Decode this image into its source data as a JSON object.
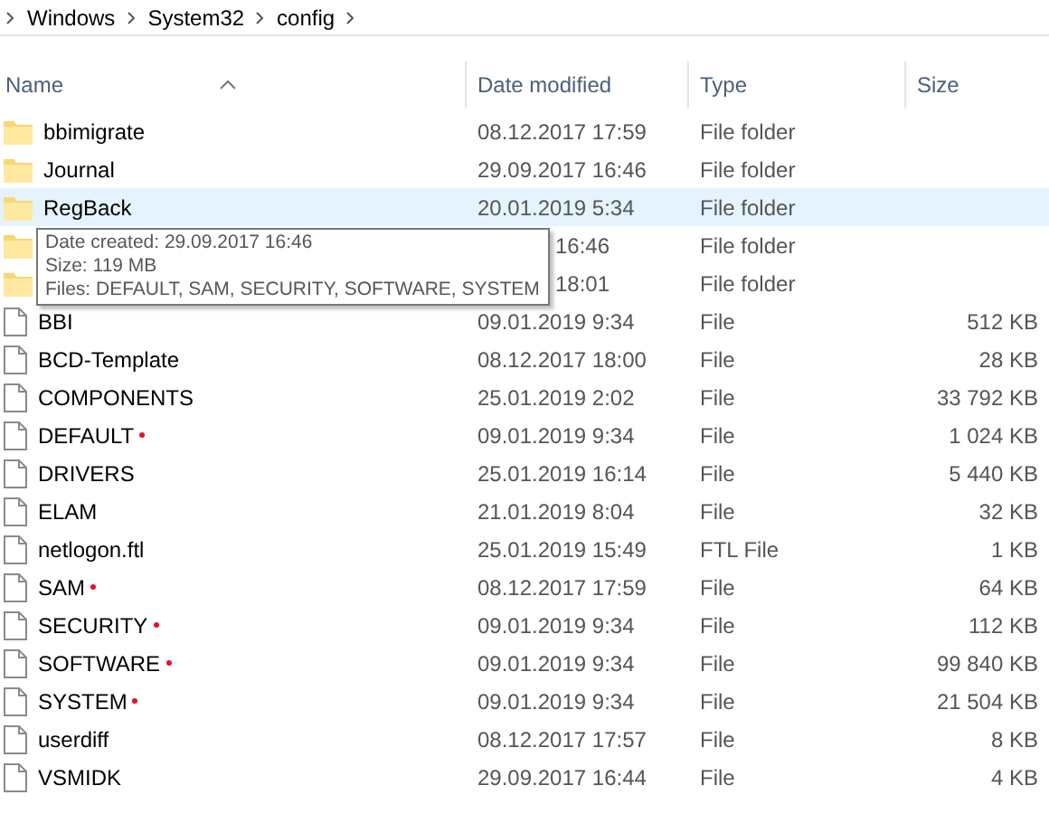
{
  "breadcrumb": [
    "Windows",
    "System32",
    "config"
  ],
  "columns": [
    {
      "label": "Name",
      "sorted": true
    },
    {
      "label": "Date modified",
      "sorted": false
    },
    {
      "label": "Type",
      "sorted": false
    },
    {
      "label": "Size",
      "sorted": false
    }
  ],
  "rows": [
    {
      "kind": "folder",
      "name": "bbimigrate",
      "date": "08.12.2017 17:59",
      "type": "File folder",
      "selected": false,
      "marked": false
    },
    {
      "kind": "folder",
      "name": "Journal",
      "date": "29.09.2017 16:46",
      "type": "File folder",
      "selected": false,
      "marked": false
    },
    {
      "kind": "folder",
      "name": "RegBack",
      "date": "20.01.2019 5:34",
      "type": "File folder",
      "selected": true,
      "marked": false
    },
    {
      "kind": "folder",
      "date": "16:46",
      "date_clipped": true,
      "type": "File folder",
      "selected": false,
      "marked": false
    },
    {
      "kind": "folder",
      "date": "18:01",
      "date_clipped": true,
      "type": "File folder",
      "selected": false,
      "marked": false
    },
    {
      "kind": "file",
      "name": "BBI",
      "date": "09.01.2019 9:34",
      "type": "File",
      "size": "512 KB",
      "selected": false,
      "marked": false
    },
    {
      "kind": "file",
      "name": "BCD-Template",
      "date": "08.12.2017 18:00",
      "type": "File",
      "size": "28 KB",
      "selected": false,
      "marked": false
    },
    {
      "kind": "file",
      "name": "COMPONENTS",
      "date": "25.01.2019 2:02",
      "type": "File",
      "size": "33 792 KB",
      "selected": false,
      "marked": false
    },
    {
      "kind": "file",
      "name": "DEFAULT",
      "date": "09.01.2019 9:34",
      "type": "File",
      "size": "1 024 KB",
      "selected": false,
      "marked": true
    },
    {
      "kind": "file",
      "name": "DRIVERS",
      "date": "25.01.2019 16:14",
      "type": "File",
      "size": "5 440 KB",
      "selected": false,
      "marked": false
    },
    {
      "kind": "file",
      "name": "ELAM",
      "date": "21.01.2019 8:04",
      "type": "File",
      "size": "32 KB",
      "selected": false,
      "marked": false
    },
    {
      "kind": "file",
      "name": "netlogon.ftl",
      "date": "25.01.2019 15:49",
      "type": "FTL File",
      "size": "1 KB",
      "selected": false,
      "marked": false
    },
    {
      "kind": "file",
      "name": "SAM",
      "date": "08.12.2017 17:59",
      "type": "File",
      "size": "64 KB",
      "selected": false,
      "marked": true
    },
    {
      "kind": "file",
      "name": "SECURITY",
      "date": "09.01.2019 9:34",
      "type": "File",
      "size": "112 KB",
      "selected": false,
      "marked": true
    },
    {
      "kind": "file",
      "name": "SOFTWARE",
      "date": "09.01.2019 9:34",
      "type": "File",
      "size": "99 840 KB",
      "selected": false,
      "marked": true
    },
    {
      "kind": "file",
      "name": "SYSTEM",
      "date": "09.01.2019 9:34",
      "type": "File",
      "size": "21 504 KB",
      "selected": false,
      "marked": true
    },
    {
      "kind": "file",
      "name": "userdiff",
      "date": "08.12.2017 17:57",
      "type": "File",
      "size": "8 KB",
      "selected": false,
      "marked": false
    },
    {
      "kind": "file",
      "name": "VSMIDK",
      "date": "29.09.2017 16:44",
      "type": "File",
      "size": "4 KB",
      "selected": false,
      "marked": false
    }
  ],
  "tooltip": [
    "Date created: 29.09.2017 16:46",
    "Size: 119 MB",
    "Files: DEFAULT, SAM, SECURITY, SOFTWARE, SYSTEM"
  ]
}
